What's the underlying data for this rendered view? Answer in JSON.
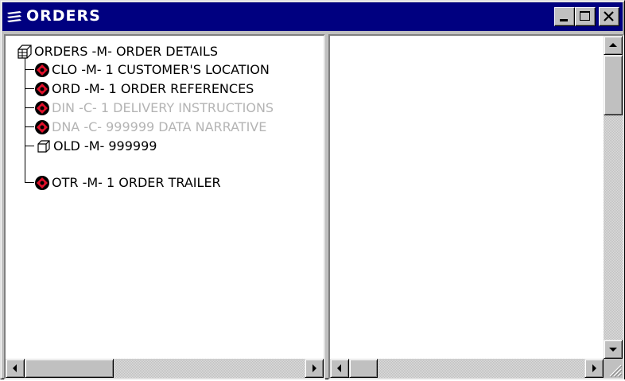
{
  "window": {
    "title": "ORDERS",
    "icon": "app-icon",
    "colors": {
      "titlebar": "#000080",
      "face": "#c0c0c0",
      "disabled_text": "#b4b4b4",
      "node_red": "#e0102a"
    }
  },
  "tree": {
    "root": {
      "label": "ORDERS -M- ORDER DETAILS",
      "icon": "table-icon"
    },
    "items": [
      {
        "label": "CLO -M- 1 CUSTOMER'S LOCATION",
        "icon": "segment-node-icon",
        "disabled": false
      },
      {
        "label": "ORD -M- 1 ORDER REFERENCES",
        "icon": "segment-node-icon",
        "disabled": false
      },
      {
        "label": "DIN -C- 1 DELIVERY INSTRUCTIONS",
        "icon": "segment-node-icon",
        "disabled": true
      },
      {
        "label": "DNA -C- 999999 DATA NARRATIVE",
        "icon": "segment-node-icon",
        "disabled": true
      },
      {
        "label": "OLD -M- 999999",
        "icon": "group-node-icon",
        "disabled": false
      },
      {
        "label": "OTR -M- 1 ORDER TRAILER",
        "icon": "segment-node-icon",
        "disabled": false
      }
    ]
  }
}
